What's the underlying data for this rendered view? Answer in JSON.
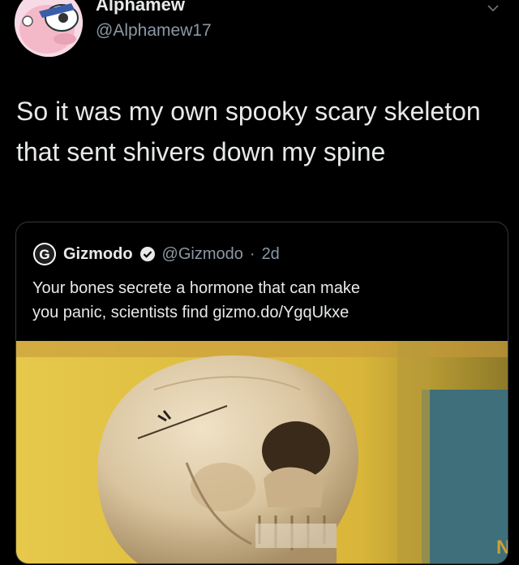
{
  "author": {
    "display_name": "Alphamew",
    "handle": "@Alphamew17"
  },
  "tweet": {
    "line1": "So it was my own spooky scary skeleton",
    "line2": "that sent shivers down my spine"
  },
  "quoted": {
    "name": "Gizmodo",
    "handle": "@Gizmodo",
    "separator": "·",
    "time": "2d",
    "line1": "Your bones secrete a hormone that can make",
    "line2": "you panic, scientists find gizmo.do/YgqUkxe",
    "logo_letter": "G"
  },
  "icons": {
    "avatar": "cartoon-bird-avatar",
    "menu": "chevron-down-icon",
    "brand": "gizmodo-logo-icon",
    "verified": "verified-badge-icon"
  },
  "colors": {
    "background": "#000000",
    "text": "#e7e9ea",
    "secondary": "#8b98a5",
    "border": "#333639"
  }
}
